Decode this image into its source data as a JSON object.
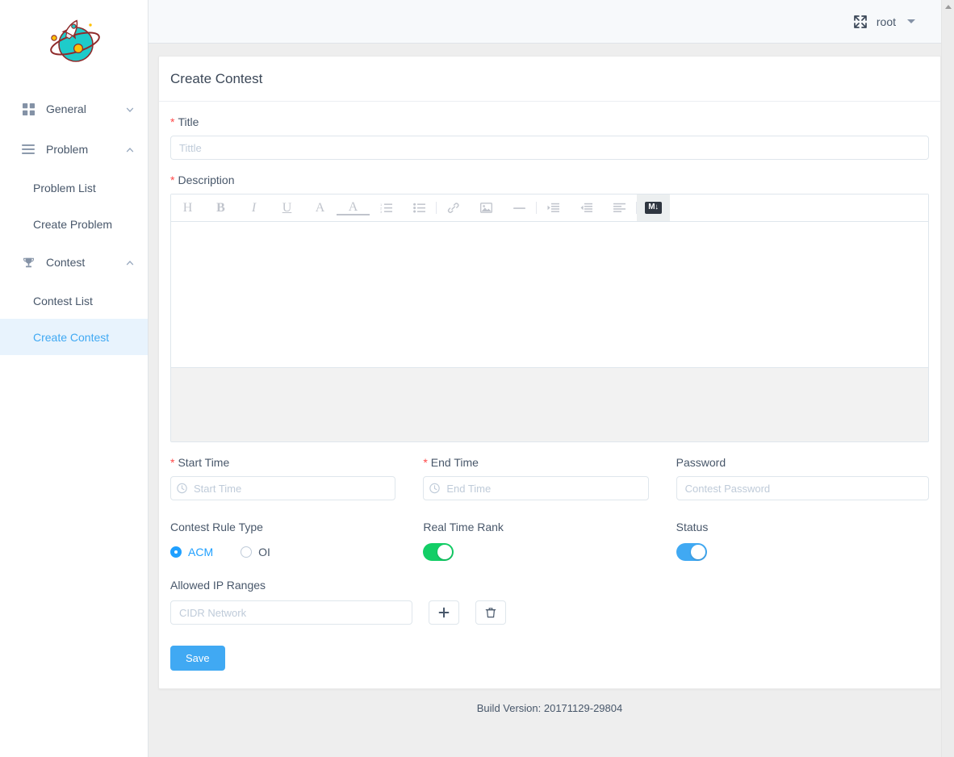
{
  "brand": {
    "logo_icon": "rocket-planet-logo",
    "planet_color": "#1ecbca",
    "orbit_color": "#8f2b2b",
    "moon_color": "#ffc107"
  },
  "topbar": {
    "expand_icon": "fullscreen-expand-icon",
    "user_name": "root",
    "caret_icon": "caret-down-icon"
  },
  "sidebar": {
    "groups": [
      {
        "label": "General",
        "icon": "grid-icon",
        "chevron": "chevron-down-icon",
        "expanded": false,
        "items": []
      },
      {
        "label": "Problem",
        "icon": "list-lines-icon",
        "chevron": "chevron-up-icon",
        "expanded": true,
        "items": [
          {
            "label": "Problem List",
            "active": false
          },
          {
            "label": "Create Problem",
            "active": false
          }
        ]
      },
      {
        "label": "Contest",
        "icon": "trophy-icon",
        "chevron": "chevron-up-icon",
        "expanded": true,
        "items": [
          {
            "label": "Contest List",
            "active": false
          },
          {
            "label": "Create Contest",
            "active": true
          }
        ]
      }
    ]
  },
  "page": {
    "title": "Create Contest",
    "required_marker": "*"
  },
  "form": {
    "title_field": {
      "label": "Title",
      "required": true,
      "value": "",
      "placeholder": "Tittle"
    },
    "description_field": {
      "label": "Description",
      "required": true,
      "value": ""
    },
    "start_time": {
      "label": "Start Time",
      "required": true,
      "value": "",
      "placeholder": "Start Time",
      "icon": "clock-icon"
    },
    "end_time": {
      "label": "End Time",
      "required": true,
      "value": "",
      "placeholder": "End Time",
      "icon": "clock-icon"
    },
    "password": {
      "label": "Password",
      "required": false,
      "value": "",
      "placeholder": "Contest Password"
    },
    "contest_rule_type": {
      "label": "Contest Rule Type",
      "options": [
        {
          "label": "ACM",
          "selected": true
        },
        {
          "label": "OI",
          "selected": false
        }
      ]
    },
    "real_time_rank": {
      "label": "Real Time Rank",
      "on": true,
      "color": "#13ce66"
    },
    "status": {
      "label": "Status",
      "on": true,
      "color": "#40a9f3"
    },
    "allowed_ip_ranges": {
      "label": "Allowed IP Ranges",
      "value": "",
      "placeholder": "CIDR Network",
      "add_icon": "plus-icon",
      "delete_icon": "trash-icon"
    },
    "save_label": "Save"
  },
  "editor": {
    "toolbar": [
      {
        "name": "heading-icon",
        "glyph": "H",
        "serif": true,
        "active": false
      },
      {
        "name": "bold-icon",
        "glyph": "B",
        "serif": true,
        "active": false
      },
      {
        "name": "italic-icon",
        "glyph": "I",
        "serif": true,
        "active": false
      },
      {
        "name": "underline-icon",
        "glyph": "U",
        "serif": true,
        "active": false
      },
      {
        "name": "font-size-icon",
        "glyph": "A",
        "serif": true,
        "active": false
      },
      {
        "name": "text-color-icon",
        "glyph": "A",
        "serif": true,
        "active": false
      },
      {
        "name": "ordered-list-icon",
        "glyph": "",
        "serif": false,
        "active": false
      },
      {
        "name": "unordered-list-icon",
        "glyph": "",
        "serif": false,
        "active": false
      },
      {
        "name": "separator",
        "glyph": "",
        "serif": false,
        "active": false
      },
      {
        "name": "link-icon",
        "glyph": "",
        "serif": false,
        "active": false
      },
      {
        "name": "image-icon",
        "glyph": "",
        "serif": false,
        "active": false
      },
      {
        "name": "horizontal-rule-icon",
        "glyph": "",
        "serif": false,
        "active": false
      },
      {
        "name": "separator",
        "glyph": "",
        "serif": false,
        "active": false
      },
      {
        "name": "indent-icon",
        "glyph": "",
        "serif": false,
        "active": false
      },
      {
        "name": "outdent-icon",
        "glyph": "",
        "serif": false,
        "active": false
      },
      {
        "name": "align-left-icon",
        "glyph": "",
        "serif": false,
        "active": false
      },
      {
        "name": "separator",
        "glyph": "",
        "serif": false,
        "active": false
      },
      {
        "name": "markdown-icon",
        "glyph": "M",
        "serif": false,
        "active": true
      }
    ],
    "markdown_badge": "M↓",
    "body_value": ""
  },
  "footer": {
    "build_version": "Build Version: 20171129-29804"
  }
}
